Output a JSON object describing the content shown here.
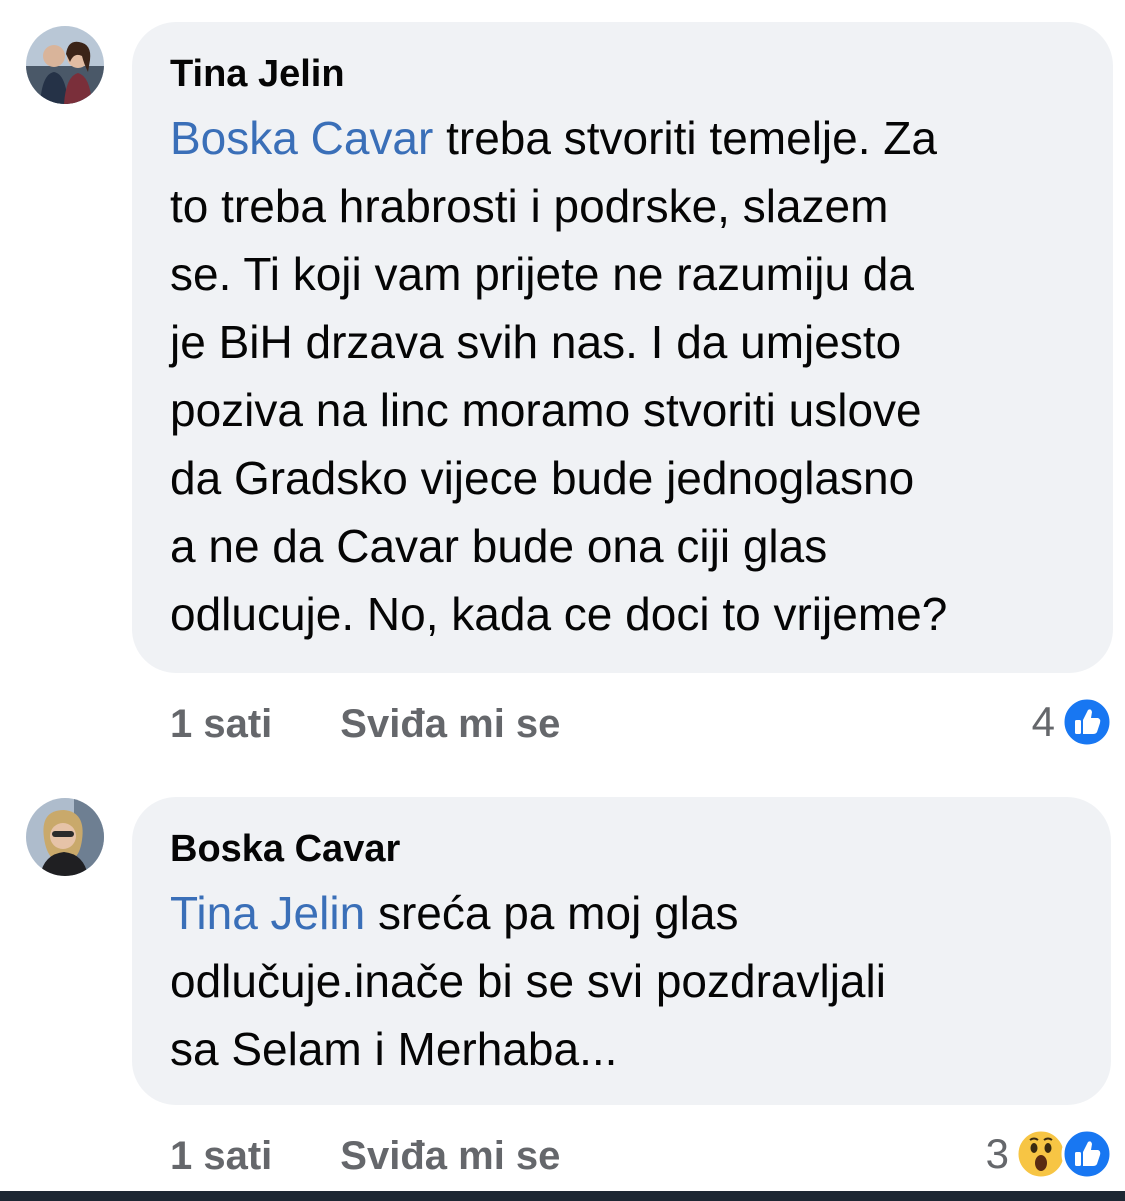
{
  "comments": [
    {
      "author": "Tina Jelin",
      "mention": "Boska Cavar",
      "text": " treba stvoriti temelje. Za\nto treba hrabrosti i podrske, slazem\nse. Ti koji vam prijete ne razumiju da\nje BiH drzava svih nas. I da umjesto\npoziva na linc moramo stvoriti uslove\nda Gradsko vijece bude jednoglasno\na ne da Cavar bude ona ciji glas\nodlucuje. No, kada ce doci to vrijeme?",
      "time": "1 sati",
      "like_label": "Sviđa mi se",
      "reaction_count": "4",
      "reactions": [
        "like-icon"
      ]
    },
    {
      "author": "Boska Cavar",
      "mention": "Tina Jelin",
      "text": " sreća pa moj glas\nodlučuje.inače bi se svi pozdravljali\nsa Selam i Merhaba...",
      "time": "1 sati",
      "like_label": "Sviđa mi se",
      "reaction_count": "3",
      "reactions": [
        "wow-icon",
        "like-icon"
      ]
    }
  ],
  "colors": {
    "bubble": "#f0f2f5",
    "mention": "#3a6fb8",
    "like_blue": "#1877f2",
    "wow_yellow": "#f7c544",
    "meta_gray": "#65676b"
  }
}
